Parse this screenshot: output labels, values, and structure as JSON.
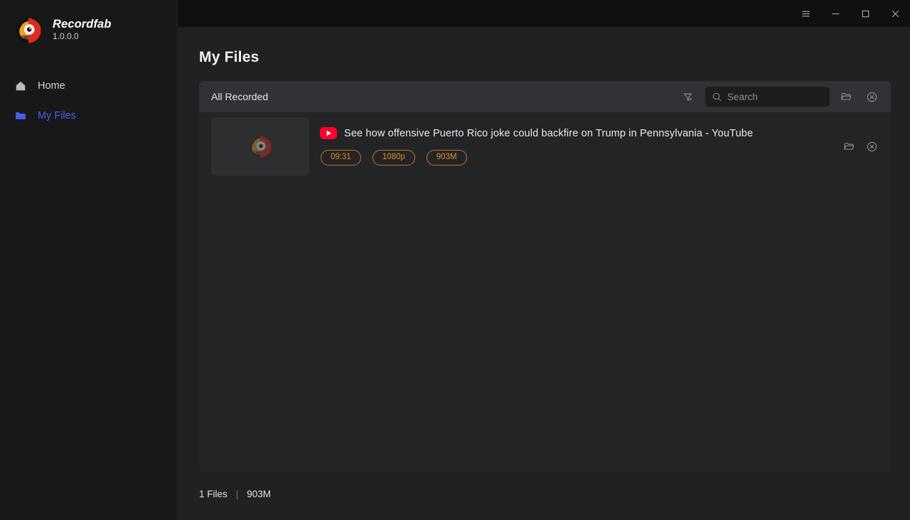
{
  "app": {
    "brand_name_bold": "Record",
    "brand_name_light": "fab",
    "version": "1.0.0.0"
  },
  "titlebar": {
    "menu_label": "menu-icon",
    "minimize_label": "minimize-icon",
    "maximize_label": "maximize-icon",
    "close_label": "close-icon"
  },
  "sidebar": {
    "items": [
      {
        "label": "Home",
        "icon": "home-icon",
        "active": false
      },
      {
        "label": "My Files",
        "icon": "folder-icon",
        "active": true
      }
    ]
  },
  "main": {
    "page_title": "My Files"
  },
  "panel": {
    "head_title": "All Recorded",
    "filter_icon": "filter-icon",
    "search": {
      "placeholder": "Search",
      "value": "",
      "icon": "search-icon"
    },
    "open_folder_icon": "folder-open-icon",
    "clear_all_icon": "circle-close-icon"
  },
  "files": [
    {
      "source_icon": "youtube-icon",
      "title": "See how offensive Puerto Rico joke could backfire on Trump in Pennsylvania - YouTube",
      "badges": [
        "09:31",
        "1080p",
        "903M"
      ],
      "open_folder_icon": "folder-open-icon",
      "delete_icon": "circle-close-icon"
    }
  ],
  "statusbar": {
    "count": "1 Files",
    "separator": "|",
    "size": "903M"
  },
  "colors": {
    "accent_blue": "#4361ee",
    "badge_orange": "#d98e2f",
    "youtube_red": "#ff0033",
    "titlebar_bg": "#0f1011",
    "sidebar_bg": "#181818",
    "content_bg": "#212121",
    "panel_bg": "#232426",
    "panel_head_bg": "#303236"
  }
}
